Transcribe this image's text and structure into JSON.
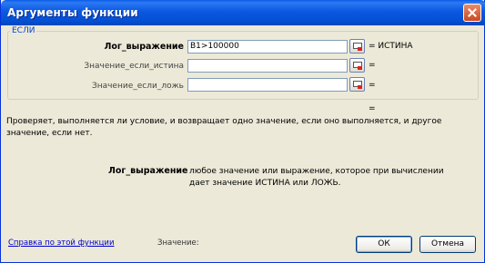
{
  "window": {
    "title": "Аргументы функции"
  },
  "group": {
    "legend": "ЕСЛИ"
  },
  "args": [
    {
      "label": "Лог_выражение",
      "value": "B1>100000",
      "result": "= ИСТИНА"
    },
    {
      "label": "Значение_если_истина",
      "value": "",
      "result": "="
    },
    {
      "label": "Значение_если_ложь",
      "value": "",
      "result": "="
    }
  ],
  "formula_result": "=",
  "description": "Проверяет, выполняется ли условие, и возвращает одно значение, если оно выполняется, и другое значение, если нет.",
  "arg_help": {
    "name": "Лог_выражение",
    "text": "любое значение или выражение, которое при вычислении дает значение ИСТИНА или ЛОЖЬ."
  },
  "footer": {
    "help_link": "Справка по этой функции",
    "value_label": "Значение:",
    "ok": "ОК",
    "cancel": "Отмена"
  },
  "icons": {
    "close": "close-icon",
    "ref": "collapse-dialog-icon"
  }
}
